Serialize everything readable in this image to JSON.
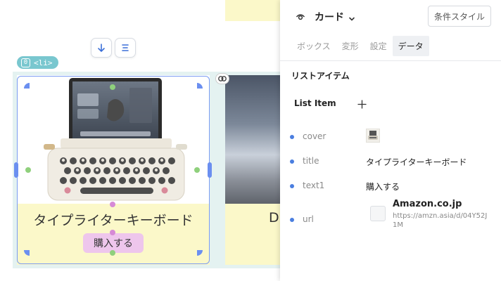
{
  "canvas": {
    "element_tag": "<li>",
    "element_index": "0",
    "cards": [
      {
        "title": "タイプライターキーボード",
        "button_label": "購入する"
      },
      {
        "title": "D."
      }
    ]
  },
  "inspector": {
    "component_name": "カード",
    "condition_style_button": "条件スタイル",
    "tabs": [
      {
        "label": "ボックス",
        "active": false
      },
      {
        "label": "変形",
        "active": false
      },
      {
        "label": "設定",
        "active": false
      },
      {
        "label": "データ",
        "active": true
      }
    ],
    "section_title": "リストアイテム",
    "list_item_label": "List Item",
    "fields": {
      "cover": {
        "key": "cover"
      },
      "title": {
        "key": "title",
        "value": "タイプライターキーボード"
      },
      "text1": {
        "key": "text1",
        "value": "購入する"
      },
      "url": {
        "key": "url",
        "link_title": "Amazon.co.jp",
        "link_url": "https://amzn.asia/d/04Y52J1M"
      }
    }
  },
  "colors": {
    "selection": "#7b9cf2",
    "card_background": "#fbf8c9",
    "button_background": "#eec6ec",
    "bullet": "#4a7ee0"
  }
}
